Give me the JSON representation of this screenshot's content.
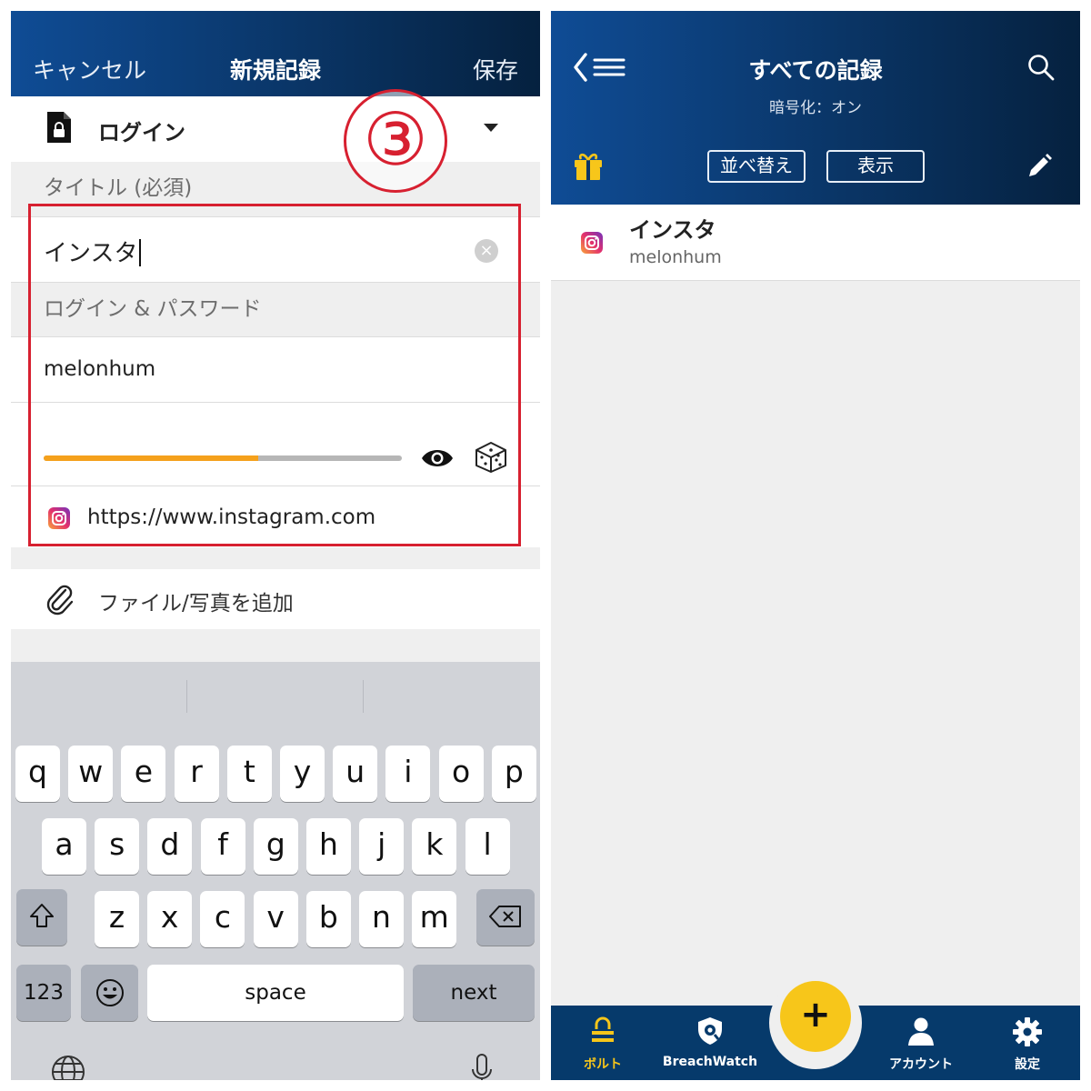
{
  "left": {
    "header": {
      "cancel": "キャンセル",
      "title": "新規記録",
      "save": "保存"
    },
    "record_type": {
      "label": "ログイン",
      "icon": "lock-document-icon"
    },
    "step_marker": "③",
    "title_section": {
      "label": "タイトル (必須)",
      "value": "インスタ",
      "clear_icon": "×"
    },
    "login_section": {
      "label": "ログイン & パスワード",
      "username": "melonhum",
      "password": ""
    },
    "password_strength": 0.6,
    "url": "https://www.instagram.com",
    "attach": {
      "label": "ファイル/写真を追加"
    },
    "colors": {
      "header_start": "#0f4c95",
      "header_end": "#05213f",
      "highlight": "#d72030",
      "strength": "#f5a11c"
    },
    "keyboard": {
      "row1": [
        "q",
        "w",
        "e",
        "r",
        "t",
        "y",
        "u",
        "i",
        "o",
        "p"
      ],
      "row2": [
        "a",
        "s",
        "d",
        "f",
        "g",
        "h",
        "j",
        "k",
        "l"
      ],
      "row3": [
        "z",
        "x",
        "c",
        "v",
        "b",
        "n",
        "m"
      ],
      "numbers_key": "123",
      "space_key": "space",
      "next_key": "next"
    }
  },
  "right": {
    "header": {
      "title": "すべての記録",
      "subtitle": "暗号化：オン",
      "sort_button": "並べ替え",
      "view_button": "表示"
    },
    "records": [
      {
        "name": "インスタ",
        "username": "melonhum"
      }
    ],
    "tabs": [
      {
        "label": "ボルト",
        "icon": "vault-icon",
        "active": true
      },
      {
        "label": "BreachWatch",
        "icon": "breachwatch-icon",
        "active": false
      },
      {
        "label": "アカウント",
        "icon": "account-icon",
        "active": false
      },
      {
        "label": "設定",
        "icon": "gear-icon",
        "active": false
      }
    ],
    "fab": "+",
    "colors": {
      "accent": "#f7c61a",
      "tabbar": "#063a6b"
    }
  }
}
